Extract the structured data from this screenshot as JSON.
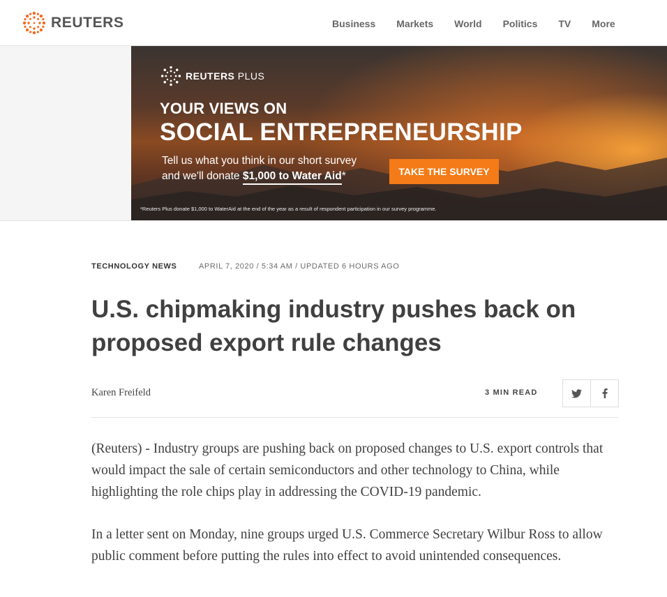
{
  "header": {
    "logo_text": "REUTERS",
    "nav": [
      "Business",
      "Markets",
      "World",
      "Politics",
      "TV",
      "More"
    ]
  },
  "ad": {
    "logo_text": "REUTERS",
    "logo_suffix": "PLUS",
    "headline_small": "YOUR VIEWS ON",
    "headline_large": "SOCIAL ENTREPRENEURSHIP",
    "copy_line1": "Tell us what you think in our short survey",
    "copy_line2_prefix": "and we'll donate ",
    "copy_highlight": "$1,000 to Water Aid",
    "copy_suffix": "*",
    "cta": "TAKE THE SURVEY",
    "footnote": "*Reuters Plus donate $1,000 to WaterAid at the end of the year as a result of respondent participation in our survey programme.",
    "accent": "#f47b17"
  },
  "article": {
    "section": "TECHNOLOGY NEWS",
    "date": "APRIL 7, 2020 / 5:34 AM / UPDATED 6 HOURS AGO",
    "headline": "U.S. chipmaking industry pushes back on proposed export rule changes",
    "author": "Karen Freifeld",
    "read_time": "3 MIN READ",
    "paragraphs": [
      "(Reuters) - Industry groups are pushing back on proposed changes to U.S. export controls that would impact the sale of certain semiconductors and other technology to China, while highlighting the role chips play in addressing the COVID-19 pandemic.",
      "In a letter sent on Monday, nine groups urged U.S. Commerce Secretary Wilbur Ross to allow public comment before putting the rules into effect to avoid unintended consequences."
    ]
  },
  "icons": {
    "logo": "reuters-logo-icon",
    "twitter": "twitter-icon",
    "facebook": "facebook-icon"
  }
}
